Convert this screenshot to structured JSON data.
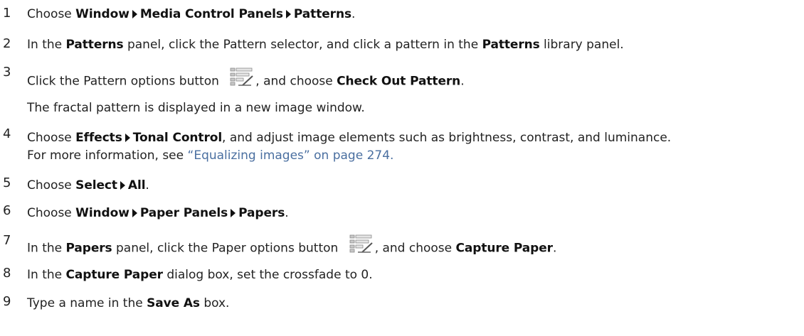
{
  "steps": [
    {
      "num": "1",
      "parts": [
        "Choose ",
        "Window",
        "Media Control Panels",
        "Patterns",
        "."
      ]
    },
    {
      "num": "2",
      "parts": [
        "In the ",
        "Patterns",
        " panel, click the Pattern selector, and click a pattern in the ",
        "Patterns",
        " library panel."
      ]
    },
    {
      "num": "3",
      "parts": [
        "Click the Pattern options button ",
        ", and choose ",
        "Check Out Pattern",
        "."
      ],
      "icon": "options-list-icon"
    },
    {
      "note": "The fractal pattern is displayed in a new image window."
    },
    {
      "num": "4",
      "parts": [
        "Choose ",
        "Effects",
        "Tonal Control",
        ", and adjust image elements such as brightness, contrast, and luminance."
      ]
    },
    {
      "line2_prefix": "For more information, see ",
      "link": "“Equalizing images” on page 274."
    },
    {
      "num": "5",
      "parts": [
        "Choose ",
        "Select",
        "All",
        "."
      ]
    },
    {
      "num": "6",
      "parts": [
        "Choose ",
        "Window",
        "Paper Panels",
        "Papers",
        "."
      ]
    },
    {
      "num": "7",
      "parts": [
        "In the ",
        "Papers",
        " panel, click the Paper options button ",
        ", and choose ",
        "Capture Paper",
        "."
      ],
      "icon": "options-list-icon"
    },
    {
      "num": "8",
      "parts": [
        "In the ",
        "Capture Paper",
        " dialog box, set the crossfade to 0."
      ]
    },
    {
      "num": "9",
      "parts": [
        "Type a name in the ",
        "Save As",
        " box."
      ]
    }
  ]
}
